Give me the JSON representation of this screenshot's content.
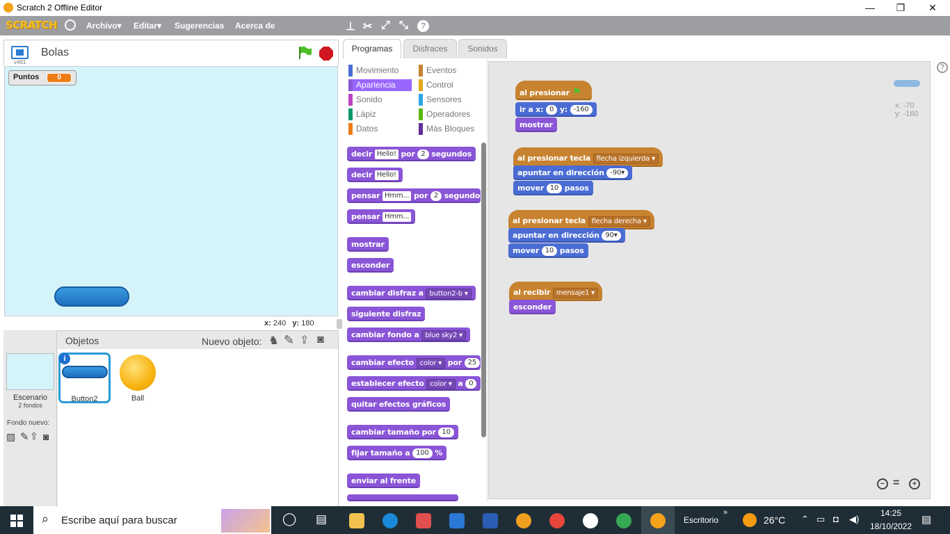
{
  "window": {
    "title": "Scratch 2 Offline Editor",
    "minimize": "—",
    "maximize": "❐",
    "close": "✕"
  },
  "menu": {
    "logo": "SCRATCH",
    "items": [
      "Archivo▾",
      "Editar▾",
      "Sugerencias",
      "Acerca de"
    ]
  },
  "stage": {
    "project_name": "Bolas",
    "version": "v461",
    "variable": {
      "name": "Puntos",
      "value": "0"
    },
    "coords": {
      "x_label": "x:",
      "x": "240",
      "y_label": "y:",
      "y": "180"
    }
  },
  "sprites": {
    "header": "Objetos",
    "new_object": "Nuevo objeto:",
    "stage_name": "Escenario",
    "stage_backdrops": "2 fondos",
    "new_backdrop": "Fondo nuevo:",
    "items": [
      {
        "name": "Button2"
      },
      {
        "name": "Ball"
      }
    ]
  },
  "tabs": [
    "Programas",
    "Disfraces",
    "Sonidos"
  ],
  "categories": {
    "left": [
      "Movimiento",
      "Apariencia",
      "Sonido",
      "Lápiz",
      "Datos"
    ],
    "right": [
      "Eventos",
      "Control",
      "Sensores",
      "Operadores",
      "Más Bloques"
    ],
    "left_colors": [
      "#4a6cd4",
      "#8a55d7",
      "#bb42c3",
      "#0e9a6c",
      "#ee7d16"
    ],
    "right_colors": [
      "#c88330",
      "#e1a91a",
      "#2ca5e2",
      "#5cb712",
      "#632d99"
    ]
  },
  "palette": {
    "say_secs": {
      "a": "decir",
      "b": "Hello!",
      "c": "por",
      "d": "2",
      "e": "segundos"
    },
    "say": {
      "a": "decir",
      "b": "Hello!"
    },
    "think_secs": {
      "a": "pensar",
      "b": "Hmm...",
      "c": "por",
      "d": "2",
      "e": "segundos"
    },
    "think": {
      "a": "pensar",
      "b": "Hmm..."
    },
    "show": "mostrar",
    "hide": "esconder",
    "switch_costume": {
      "a": "cambiar disfraz a",
      "b": "button2-b ▾"
    },
    "next_costume": "siguiente disfraz",
    "switch_backdrop": {
      "a": "cambiar fondo a",
      "b": "blue sky2 ▾"
    },
    "change_effect": {
      "a": "cambiar efecto",
      "b": "color ▾",
      "c": "por",
      "d": "25"
    },
    "set_effect": {
      "a": "establecer efecto",
      "b": "color ▾",
      "c": "a",
      "d": "0"
    },
    "clear_effects": "quitar efectos gráficos",
    "change_size": {
      "a": "cambiar tamaño por",
      "b": "10"
    },
    "set_size": {
      "a": "fijar tamaño a",
      "b": "100",
      "c": "%"
    },
    "front": "enviar al frente"
  },
  "scripts": {
    "s1": {
      "hat": "al presionar",
      "goto": {
        "a": "ir a x:",
        "b": "0",
        "c": "y:",
        "d": "-160"
      },
      "show": "mostrar"
    },
    "s2": {
      "hat": {
        "a": "al presionar tecla",
        "b": "flecha izquierda ▾"
      },
      "point": {
        "a": "apuntar en dirección",
        "b": "-90▾"
      },
      "move": {
        "a": "mover",
        "b": "10",
        "c": "pasos"
      }
    },
    "s3": {
      "hat": {
        "a": "al presionar tecla",
        "b": "flecha derecha ▾"
      },
      "point": {
        "a": "apuntar en dirección",
        "b": "90▾"
      },
      "move": {
        "a": "mover",
        "b": "10",
        "c": "pasos"
      }
    },
    "s4": {
      "hat": {
        "a": "al recibir",
        "b": "mensaje1 ▾"
      },
      "hide": "esconder"
    },
    "sprite_coords": {
      "x": "x: -70",
      "y": "y: -160"
    }
  },
  "taskbar": {
    "search_placeholder": "Escribe aquí para buscar",
    "desktop": "Escritorio",
    "temperature": "26°C",
    "time": "14:25",
    "date": "18/10/2022"
  }
}
